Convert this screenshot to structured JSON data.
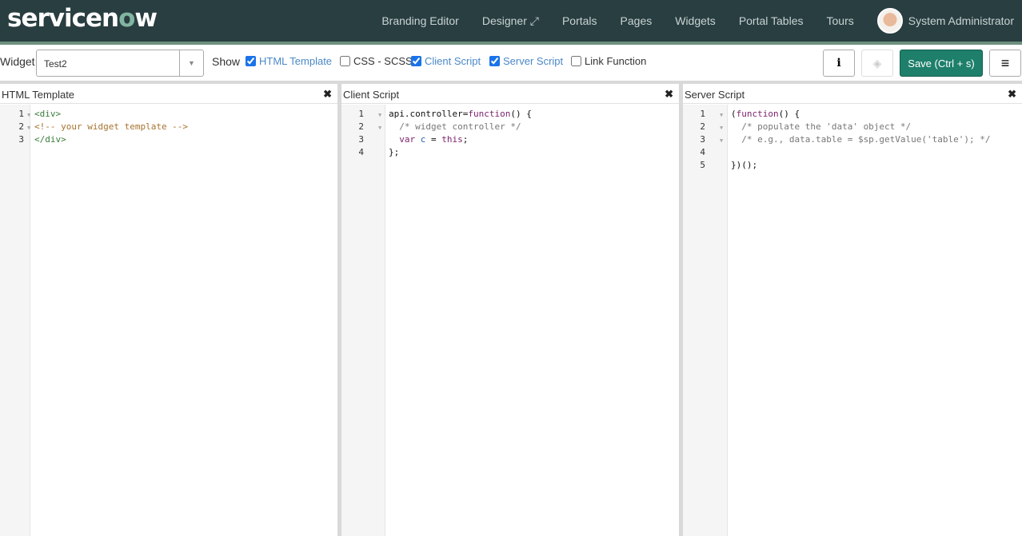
{
  "nav": {
    "logo": "servicenow",
    "items": [
      "Branding Editor",
      "Designer ⤢",
      "Portals",
      "Pages",
      "Widgets",
      "Portal Tables",
      "Tours"
    ],
    "user": "System Administrator"
  },
  "toolbar": {
    "widget_label": "Widget",
    "widget_value": "Test2",
    "show_label": "Show",
    "options": [
      {
        "label": "HTML Template",
        "checked": true
      },
      {
        "label": "CSS - SCSS",
        "checked": false
      },
      {
        "label": "Client Script",
        "checked": true
      },
      {
        "label": "Server Script",
        "checked": true
      },
      {
        "label": "Link Function",
        "checked": false
      }
    ],
    "info_icon": "info-icon",
    "preview_icon": "eye-slash-icon",
    "save_label": "Save (Ctrl + s)",
    "menu_icon": "hamburger-icon"
  },
  "colors": {
    "navbar": "#293e40",
    "save": "#1e7f6b",
    "link": "#4a88c7"
  },
  "panels": [
    {
      "title": "HTML Template",
      "lines": [
        [
          {
            "c": "tag",
            "t": "<div>"
          }
        ],
        [
          {
            "c": "com",
            "t": "<!-- your widget template -->"
          }
        ],
        [
          {
            "c": "tag",
            "t": "</div>"
          }
        ]
      ]
    },
    {
      "title": "Client Script",
      "lines": [
        [
          {
            "c": "pl",
            "t": "api.controller="
          },
          {
            "c": "kw",
            "t": "function"
          },
          {
            "c": "pl",
            "t": "() {"
          }
        ],
        [
          {
            "c": "gray",
            "t": "  /* widget controller */"
          }
        ],
        [
          {
            "c": "kw",
            "t": "  var "
          },
          {
            "c": "var",
            "t": "c"
          },
          {
            "c": "pl",
            "t": " = "
          },
          {
            "c": "kw",
            "t": "this"
          },
          {
            "c": "pl",
            "t": ";"
          }
        ],
        [
          {
            "c": "pl",
            "t": "};"
          }
        ]
      ]
    },
    {
      "title": "Server Script",
      "lines": [
        [
          {
            "c": "pl",
            "t": "("
          },
          {
            "c": "kw",
            "t": "function"
          },
          {
            "c": "pl",
            "t": "() {"
          }
        ],
        [
          {
            "c": "gray",
            "t": "  /* populate the 'data' object */"
          }
        ],
        [
          {
            "c": "gray",
            "t": "  /* e.g., data.table = $sp.getValue('table'); */"
          }
        ],
        [
          {
            "c": "pl",
            "t": ""
          }
        ],
        [
          {
            "c": "pl",
            "t": "})();"
          }
        ]
      ]
    }
  ]
}
